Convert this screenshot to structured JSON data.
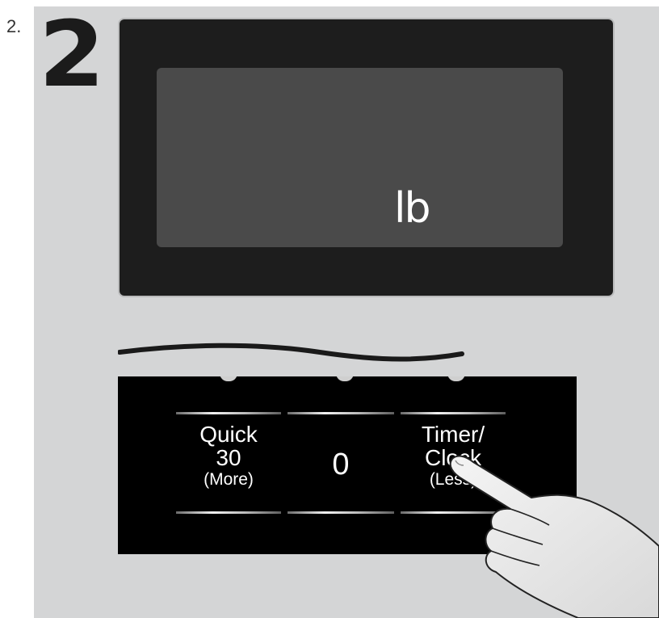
{
  "step": {
    "label": "2.",
    "number": "2"
  },
  "display": {
    "unit": "lb"
  },
  "keypad": {
    "keys": [
      {
        "line1": "Quick",
        "line2": "30",
        "line3": "(More)"
      },
      {
        "value": "0"
      },
      {
        "line1": "Timer/",
        "line2": "Clock",
        "line3": "(Less)"
      }
    ]
  },
  "colors": {
    "panel": "#d4d5d6",
    "bezel": "#1d1d1d",
    "screen": "#4a4a4a",
    "keypad": "#000000"
  }
}
